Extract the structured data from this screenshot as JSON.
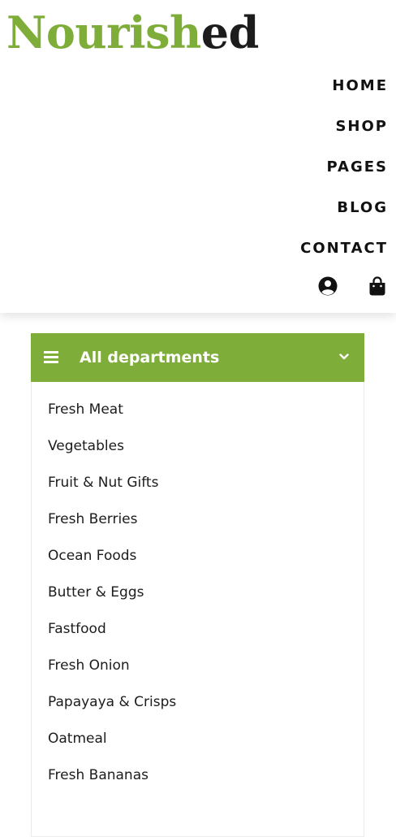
{
  "brand": {
    "part1": "Nourish",
    "part2": "ed",
    "green": "#7fad39",
    "dark": "#1c1c1c"
  },
  "nav": {
    "items": [
      {
        "label": "HOME"
      },
      {
        "label": "SHOP"
      },
      {
        "label": "PAGES"
      },
      {
        "label": "BLOG"
      },
      {
        "label": "CONTACT"
      }
    ],
    "icons": [
      "user-circle-icon",
      "shopping-bag-icon"
    ]
  },
  "departments": {
    "title": "All departments",
    "menu_icon": "hamburger-icon",
    "toggle_icon": "chevron-down-icon",
    "header_color": "#7fad39",
    "items": [
      {
        "label": "Fresh Meat"
      },
      {
        "label": "Vegetables"
      },
      {
        "label": "Fruit & Nut Gifts"
      },
      {
        "label": "Fresh Berries"
      },
      {
        "label": "Ocean Foods"
      },
      {
        "label": "Butter & Eggs"
      },
      {
        "label": "Fastfood"
      },
      {
        "label": "Fresh Onion"
      },
      {
        "label": "Papayaya & Crisps"
      },
      {
        "label": "Oatmeal"
      },
      {
        "label": "Fresh Bananas"
      }
    ]
  }
}
